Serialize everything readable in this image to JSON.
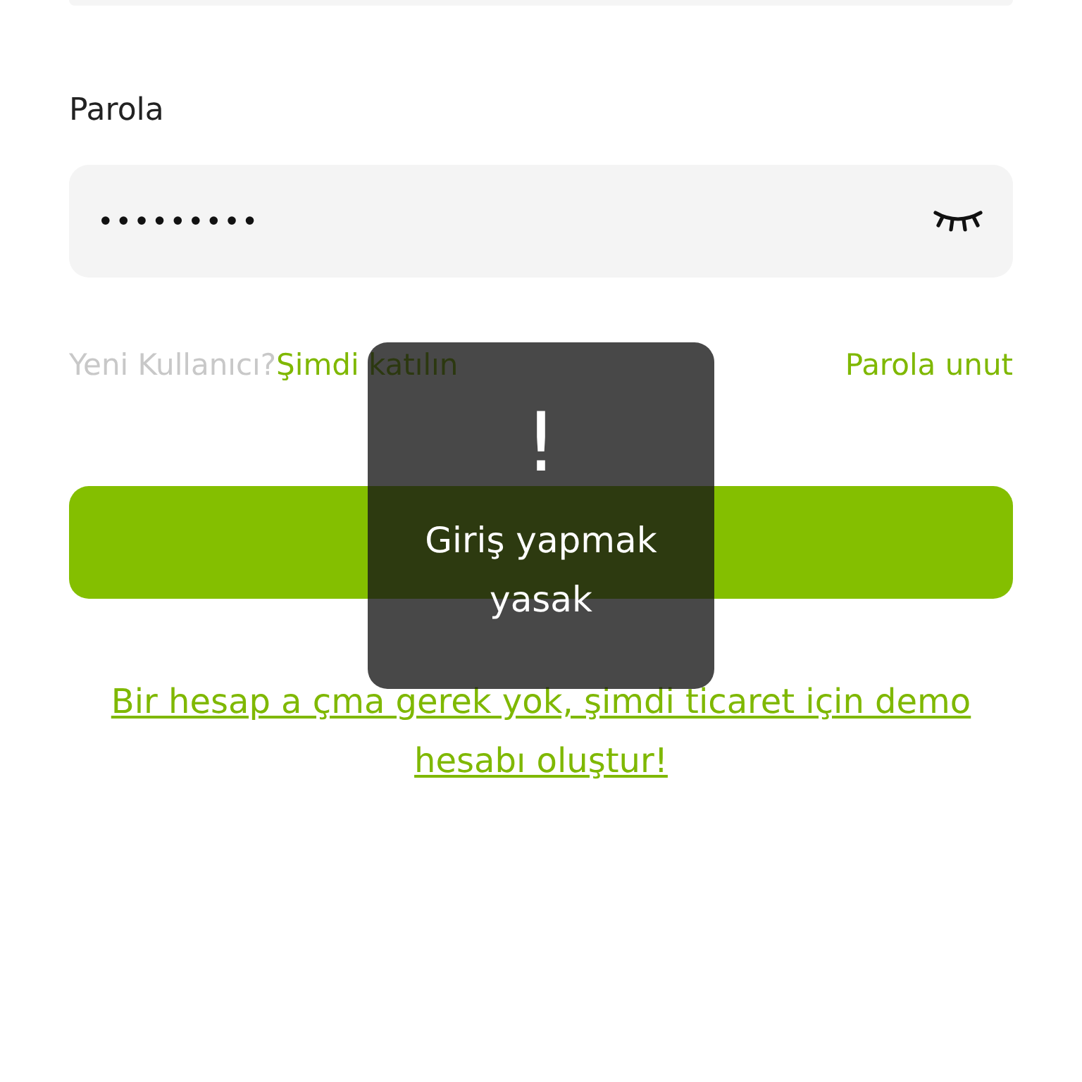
{
  "password": {
    "label": "Parola",
    "value": "•••••••••",
    "revealed": false
  },
  "links": {
    "prompt": "Yeni Kullanıcı?",
    "join": "Şimdi katılın",
    "forgot": "Parola unut"
  },
  "demo_link": "Bir hesap a çma gerek yok, şimdi ticaret için demo hesabı oluştur!",
  "toast": {
    "icon": "!",
    "message": "Giriş yapmak yasak"
  }
}
